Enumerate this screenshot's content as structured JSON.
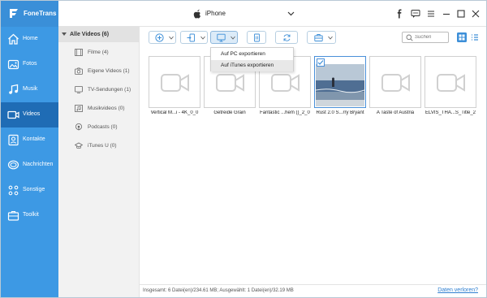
{
  "app": {
    "name": "FoneTrans"
  },
  "device": {
    "name": "iPhone"
  },
  "colors": {
    "nav_bg": "#3d99e4",
    "nav_active": "#1f6cb5",
    "link": "#2f7fd0",
    "selection": "#4a90d9"
  },
  "nav": {
    "items": [
      {
        "label": "Home",
        "icon": "home-icon"
      },
      {
        "label": "Fotos",
        "icon": "photos-icon"
      },
      {
        "label": "Musik",
        "icon": "music-icon"
      },
      {
        "label": "Videos",
        "icon": "video-icon",
        "active": true
      },
      {
        "label": "Kontakte",
        "icon": "contacts-icon"
      },
      {
        "label": "Nachrichten",
        "icon": "messages-icon"
      },
      {
        "label": "Sonstige",
        "icon": "other-icon"
      },
      {
        "label": "Toolkit",
        "icon": "toolkit-icon"
      }
    ]
  },
  "categories": {
    "header": "Alle Videos (6)",
    "items": [
      {
        "label": "Filme (4)",
        "icon": "film-icon"
      },
      {
        "label": "Eigene Videos (1)",
        "icon": "camera-icon"
      },
      {
        "label": "TV-Sendungen (1)",
        "icon": "tv-icon"
      },
      {
        "label": "Musikvideos (0)",
        "icon": "music-video-icon"
      },
      {
        "label": "Podcasts (0)",
        "icon": "podcast-icon"
      },
      {
        "label": "iTunes U (0)",
        "icon": "itunes-u-icon"
      }
    ]
  },
  "search": {
    "placeholder": "Suchen"
  },
  "export_menu": {
    "items": [
      "Auf PC exportieren",
      "Auf iTunes exportieren"
    ]
  },
  "videos": [
    {
      "title": "Vertical M...i - 4K_0_0"
    },
    {
      "title": "Getreide   Grain"
    },
    {
      "title": "Fantastic ...hem ()_2_0"
    },
    {
      "title": "Rust 2.0 S...rry Bryant",
      "selected": true
    },
    {
      "title": "A Taste of Austria"
    },
    {
      "title": "ELVIS_THA...S_Title_2"
    }
  ],
  "status": {
    "summary": "Insgesamt: 6 Datei(en)/234.61 MB; Ausgewählt: 1 Datei(en)/32.19 MB",
    "lost_link": "Daten verloren?"
  }
}
